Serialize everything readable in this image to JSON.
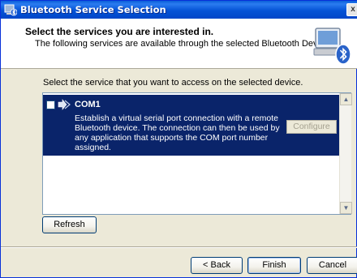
{
  "window": {
    "title": "Bluetooth Service Selection",
    "close_glyph": "x"
  },
  "header": {
    "heading": "Select the services you are interested in.",
    "subheading": "The following services are available through the selected Bluetooth Device."
  },
  "prompt": "Select the service that you want to access on the selected device.",
  "services": [
    {
      "name": "COM1",
      "checked": false,
      "description": "Establish a virtual serial port connection with a remote Bluetooth device. The connection can then be used by any application that supports the COM port number assigned.",
      "configure_label": "Configure"
    }
  ],
  "buttons": {
    "refresh": "Refresh",
    "back": "< Back",
    "finish": "Finish",
    "cancel": "Cancel"
  },
  "icons": {
    "app": "bluetooth-app-icon",
    "device": "bluetooth-device-icon",
    "service": "bluetooth-service-icon"
  },
  "colors": {
    "titlebar": "#0553d6",
    "selection": "#0a246a",
    "dialog_bg": "#ece9d8"
  }
}
